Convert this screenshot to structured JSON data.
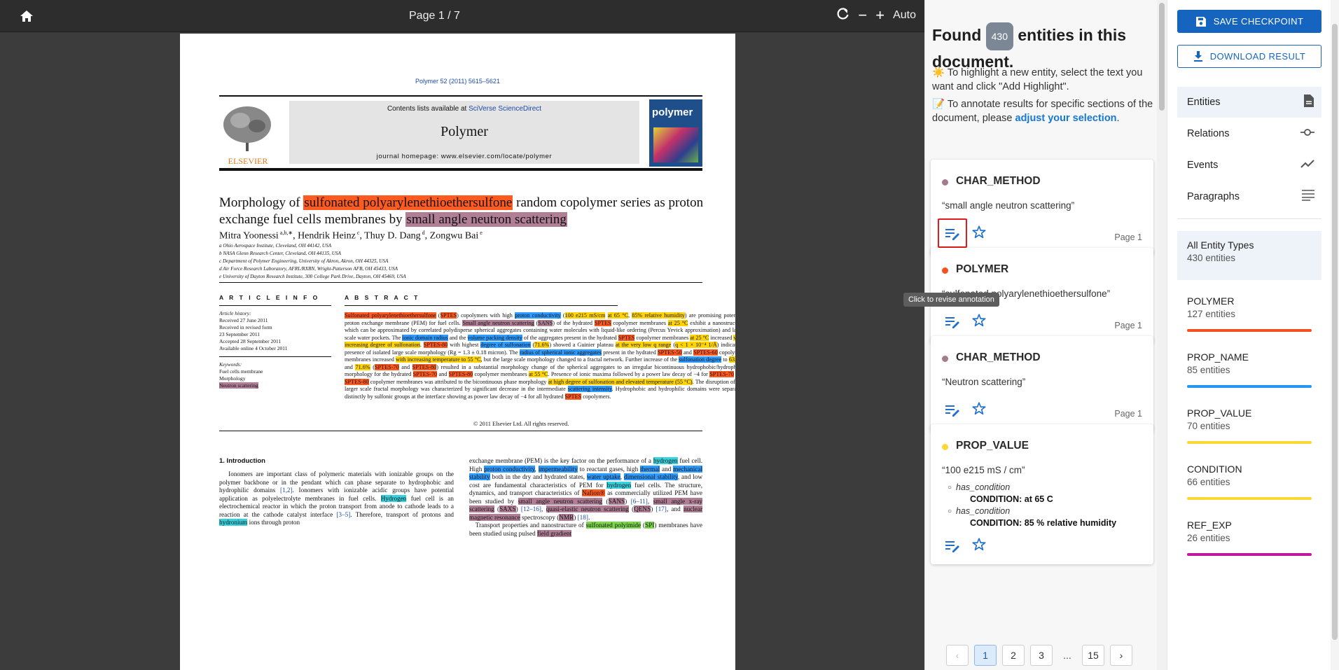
{
  "toolbar": {
    "page_indicator": "Page 1 / 7",
    "zoom_label": "Auto",
    "icons": [
      "home-icon",
      "refresh-icon",
      "zoom-out-icon",
      "zoom-in-icon"
    ]
  },
  "paper": {
    "journal_ref": "Polymer 52 (2011) 5615–5621",
    "contents_prefix": "Contents lists available at ",
    "contents_link": "SciVerse ScienceDirect",
    "journal_name": "Polymer",
    "homepage": "journal homepage: www.elsevier.com/locate/polymer",
    "publisher": "ELSEVIER",
    "cover_title": "polymer",
    "title": {
      "t1": "Morphology of ",
      "t2": "sulfonated polyarylenethioethersulfone",
      "t3": " random copolymer series as proton exchange fuel cells membranes by ",
      "t4": "small angle neutron scattering"
    },
    "authors": {
      "a1": "Mitra Yoonessi",
      "s1": " a,b,",
      "a2": ", Hendrik Heinz",
      "s2": " c",
      "a3": ", Thuy D. Dang",
      "s3": " d",
      "a4": ", Zongwu Bai",
      "s4": " e",
      "star": "∗"
    },
    "affiliations": [
      "a Ohio Aerospace Institute, Cleveland, OH 44142, USA",
      "b NASA Glenn Research Center, Cleveland, OH 44135, USA",
      "c Department of Polymer Engineering, University of Akron, Akron, OH 44325, USA",
      "d Air Force Research Laboratory, AFRL/RXBN, Wright-Patterson AFB, OH 45433, USA",
      "e University of Dayton Research Institute, 300 College Park Drive, Dayton, OH 45469, USA"
    ],
    "article_info_head": "A R T I C L E   I N F O",
    "history": [
      "Article history:",
      "Received 27 June 2011",
      "Received in revised form",
      "23 September 2011",
      "Accepted 28 September 2011",
      "Available online 4 October 2011"
    ],
    "keywords": [
      "Keywords:",
      "Fuel cells membrane",
      "Morphology",
      "Neutron scattering"
    ],
    "abstract_head": "A B S T R A C T",
    "copyright": "© 2011 Elsevier Ltd. All rights reserved.",
    "intro_head": "1.  Introduction"
  },
  "sidebar": {
    "found_prefix": "Found ",
    "found_count": "430",
    "found_suffix": " entities in this document.",
    "tip1": "☀️ To highlight a new entity, select the text you want and click \"Add Highlight\".",
    "tip2_prefix": "📝 To annotate results for specific sections of the document, please ",
    "tip2_link": "adjust your selection",
    "tip2_suffix": ".",
    "tooltip": "Click to revise annotation",
    "cards": [
      {
        "label": "CHAR_METHOD",
        "color": "#a27b8d",
        "text": "“small angle neutron scattering”",
        "page": "Page 1"
      },
      {
        "label": "POLYMER",
        "color": "#f4511e",
        "text": "“sulfonated polyarylenethioethersulfone”",
        "page": "Page 1"
      },
      {
        "label": "CHAR_METHOD",
        "color": "#a27b8d",
        "text": "“Neutron scattering”",
        "page": "Page 1"
      },
      {
        "label": "PROP_VALUE",
        "color": "#fdd835",
        "text": "“100 e215 mS / cm”",
        "conditions": [
          {
            "key": "has_condition",
            "value": "CONDITION: at 65 C"
          },
          {
            "key": "has_condition",
            "value": "CONDITION: 85 % relative humidity"
          }
        ]
      }
    ],
    "pager": {
      "pages": [
        "1",
        "2",
        "3"
      ],
      "ellipsis": "...",
      "last": "15",
      "prev": "‹",
      "next": "›"
    }
  },
  "rpanel": {
    "save_label": "SAVE CHECKPOINT",
    "download_label": "DOWNLOAD RESULT",
    "nav": [
      {
        "label": "Entities",
        "icon": "document-icon"
      },
      {
        "label": "Relations",
        "icon": "relation-icon"
      },
      {
        "label": "Events",
        "icon": "trend-icon"
      },
      {
        "label": "Paragraphs",
        "icon": "paragraph-icon"
      }
    ],
    "types": [
      {
        "name": "All Entity Types",
        "count": "430 entities"
      },
      {
        "name": "POLYMER",
        "count": "127 entities",
        "color": "#f4511e"
      },
      {
        "name": "PROP_NAME",
        "count": "85 entities",
        "color": "#2196f3"
      },
      {
        "name": "PROP_VALUE",
        "count": "70 entities",
        "color": "#fdd835"
      },
      {
        "name": "CONDITION",
        "count": "66 entities",
        "color": "#fdd835"
      },
      {
        "name": "REF_EXP",
        "count": "26 entities",
        "color": "#c2189a"
      }
    ]
  }
}
